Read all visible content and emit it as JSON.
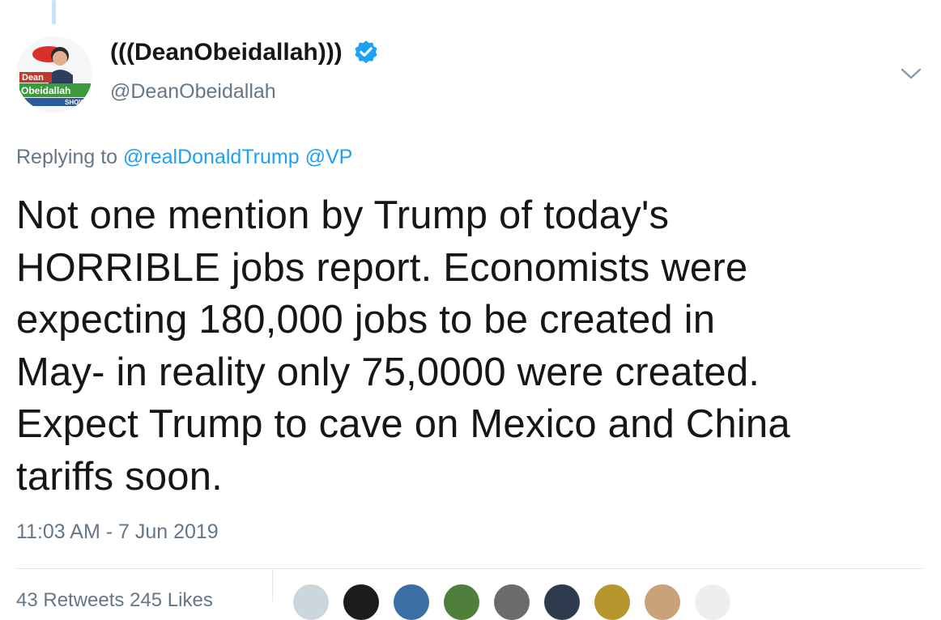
{
  "tweet": {
    "display_name": "(((DeanObeidallah)))",
    "handle": "@DeanObeidallah",
    "avatar_logo": {
      "line1": "Dean",
      "line2": "Obeidallah",
      "line3": "SHOW"
    },
    "replying_prefix": "Replying to",
    "replying_to": [
      "@realDonaldTrump",
      "@VP"
    ],
    "text_lines": [
      "Not one mention by Trump of today's",
      "HORRIBLE jobs report. Economists were",
      "expecting 180,000 jobs to be created in",
      "May- in reality only 75,0000 were created.",
      "Expect Trump to cave on Mexico and China",
      "tariffs soon."
    ],
    "timestamp": "11:03 AM - 7 Jun 2019",
    "stats_partial": "43 Retweets   245 Likes"
  },
  "colors": {
    "link": "#1da1f2",
    "muted": "#657786",
    "text": "#14171a",
    "verified": "#1da1f2"
  },
  "icons": [
    "verified-badge-icon",
    "chevron-down-icon"
  ]
}
